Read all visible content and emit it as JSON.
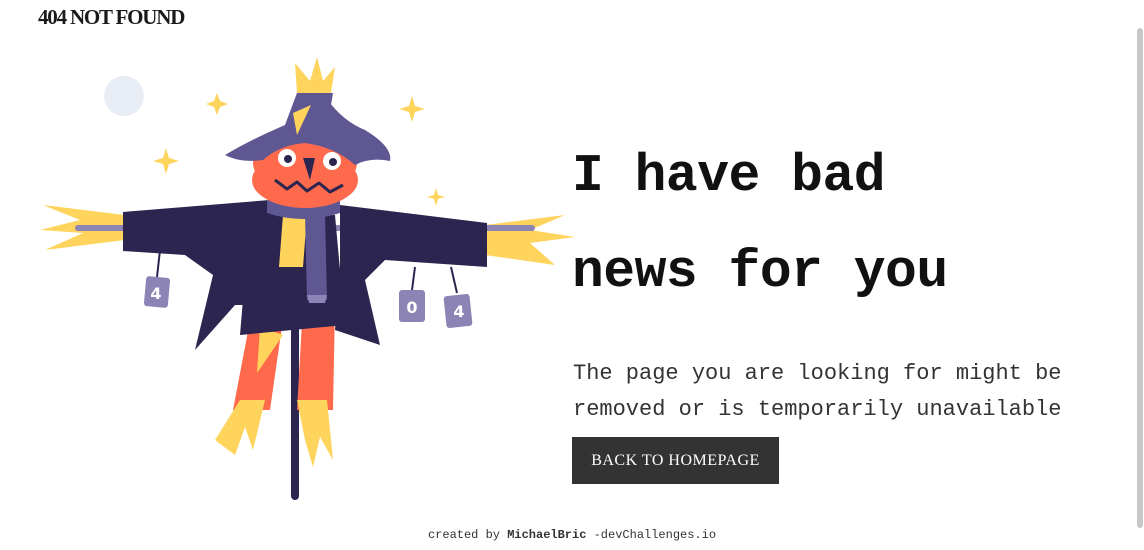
{
  "header": {
    "brand": "404 NOT FOUND"
  },
  "illustration": {
    "icon": "scarecrow-illustration",
    "can_labels": [
      "4",
      "0",
      "4"
    ],
    "colors": {
      "hat": "#5f5791",
      "coat": "#2b2550",
      "face": "#ff6a4d",
      "straw": "#ffd45c",
      "moon": "#e8ecf4"
    }
  },
  "main": {
    "headline_line1": "I have bad",
    "headline_line2": "news for you",
    "message": "The page you are looking for might be removed or is temporarily unavailable",
    "button_label": "BACK TO HOMEPAGE"
  },
  "footer": {
    "prefix": "created by ",
    "author": "MichaelBric",
    "suffix": " -devChallenges.io"
  }
}
